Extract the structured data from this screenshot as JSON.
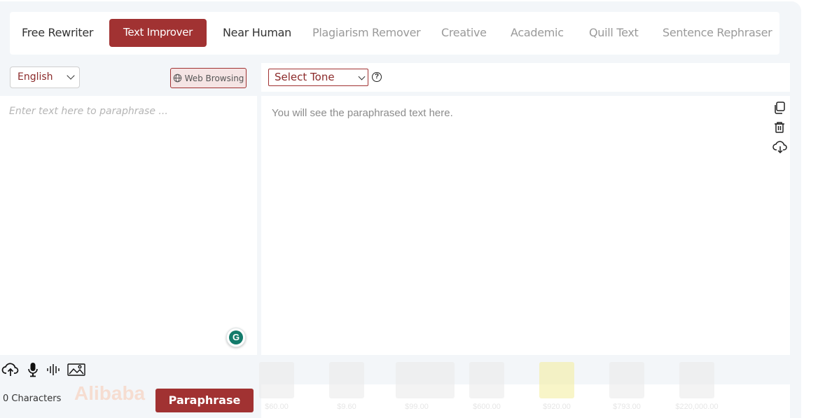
{
  "tabs": [
    {
      "label": "Free Rewriter",
      "state": "normal"
    },
    {
      "label": "Text Improver",
      "state": "active"
    },
    {
      "label": "Near Human",
      "state": "normal"
    },
    {
      "label": "Plagiarism Remover",
      "state": "muted"
    },
    {
      "label": "Creative",
      "state": "muted"
    },
    {
      "label": "Academic",
      "state": "muted"
    },
    {
      "label": "Quill Text",
      "state": "muted"
    },
    {
      "label": "Sentence Rephraser",
      "state": "muted"
    }
  ],
  "language": {
    "selected": "English"
  },
  "web_browsing": {
    "label": "Web Browsing"
  },
  "tone": {
    "selected": "Select Tone",
    "help": "?"
  },
  "input": {
    "placeholder": "Enter text here to paraphrase ..."
  },
  "output": {
    "placeholder": "You will see the paraphrased text here."
  },
  "grammarly": {
    "letter": "G"
  },
  "footer": {
    "characters": "0 Characters",
    "paraphrase_label": "Paraphrase"
  },
  "ad": {
    "brand": "Alibaba",
    "prices": [
      "$60.00",
      "$9.60",
      "$99.00",
      "$600.00",
      "$920.00",
      "$793.00",
      "$220,000.00"
    ]
  },
  "colors": {
    "accent": "#a13232",
    "muted_text": "#9a9a9a",
    "panel_bg": "#f3f6f9"
  },
  "icons": {
    "output": [
      "copy-icon",
      "trash-icon",
      "cloud-download-icon"
    ],
    "input_tools": [
      "cloud-upload-icon",
      "microphone-icon",
      "soundwave-icon",
      "image-icon"
    ]
  }
}
